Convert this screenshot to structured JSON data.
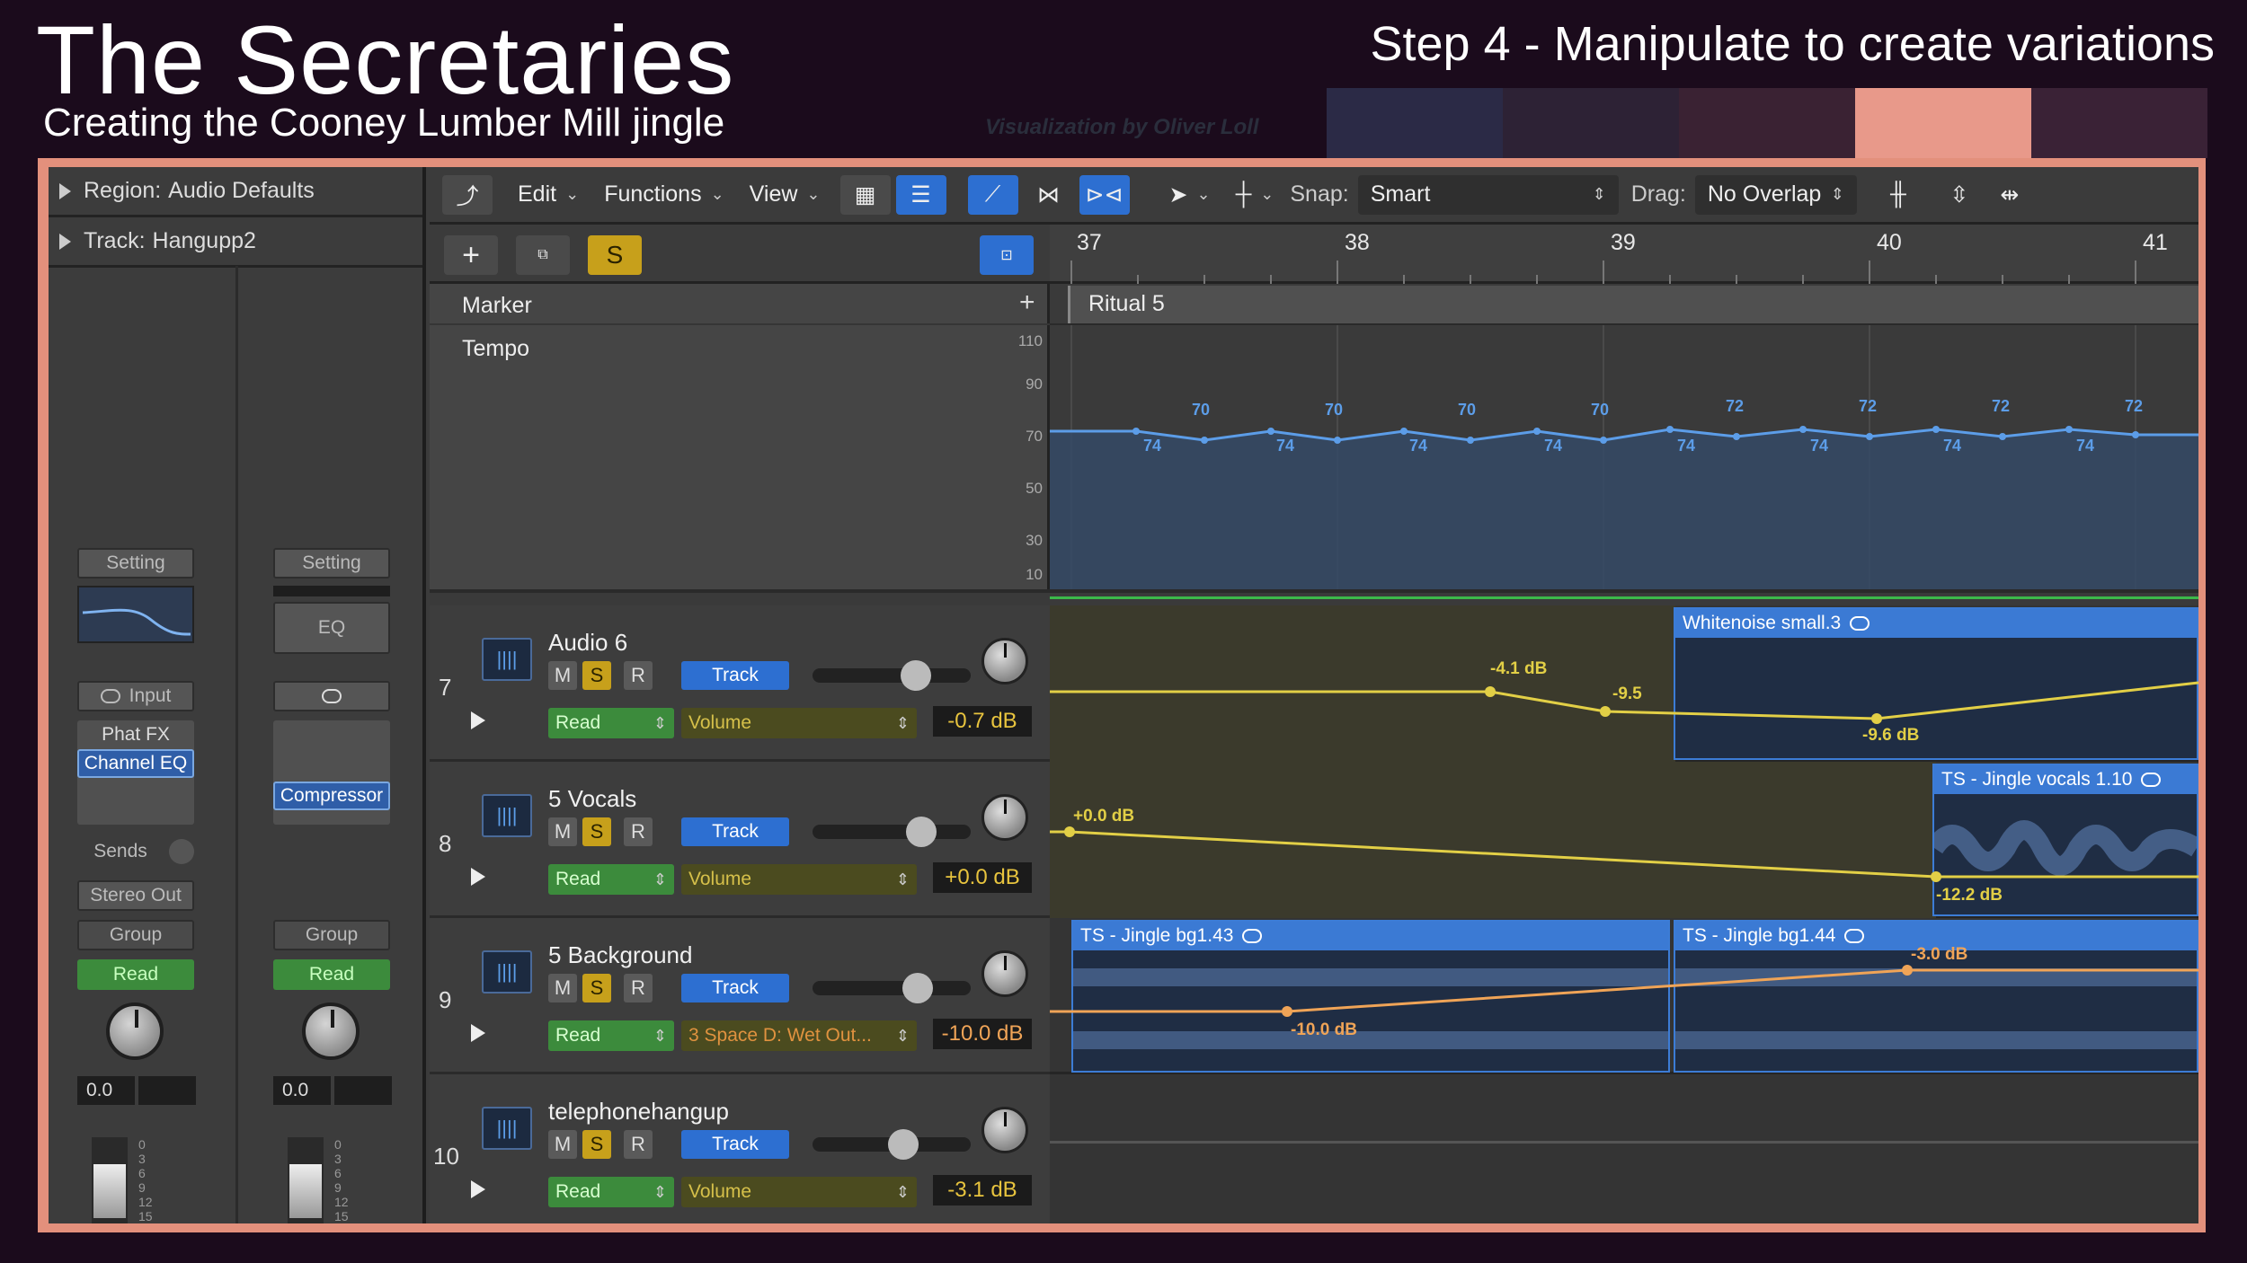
{
  "header": {
    "title": "The Secretaries",
    "subtitle": "Creating the Cooney Lumber Mill jingle",
    "step": "Step 4 - Manipulate to create variations",
    "credit": "Visualization by Oliver Loll"
  },
  "swatches": [
    "#2b2a46",
    "#2d2235",
    "#3a2233",
    "#e8998a",
    "#3a2236"
  ],
  "inspector": {
    "region_label": "Region:",
    "region_value": "Audio Defaults",
    "track_label": "Track:",
    "track_value": "Hangupp2",
    "strip1": {
      "setting": "Setting",
      "input": "Input",
      "plugin1": "Phat FX",
      "plugin2": "Channel EQ",
      "sends": "Sends",
      "output": "Stereo Out",
      "group": "Group",
      "read": "Read",
      "pan_value": "0.0"
    },
    "strip2": {
      "setting": "Setting",
      "eq": "EQ",
      "plugin": "Compressor",
      "group": "Group",
      "read": "Read",
      "pan_value": "0.0"
    },
    "meter_ticks": [
      "0",
      "3",
      "6",
      "9",
      "12",
      "15"
    ]
  },
  "toolbar": {
    "edit": "Edit",
    "functions": "Functions",
    "view": "View",
    "snap_label": "Snap:",
    "snap_value": "Smart",
    "drag_label": "Drag:",
    "drag_value": "No Overlap",
    "solo": "S"
  },
  "ruler": {
    "bars": [
      "37",
      "38",
      "39",
      "40",
      "41"
    ]
  },
  "globals": {
    "marker_label": "Marker",
    "tempo_label": "Tempo",
    "marker_name": "Ritual 5",
    "tempo_scale": [
      "110",
      "90",
      "70",
      "50",
      "30",
      "10"
    ],
    "tempo_upper": [
      "70",
      "70",
      "70",
      "70",
      "72",
      "72",
      "72",
      "72"
    ],
    "tempo_lower": [
      "74",
      "74",
      "74",
      "74",
      "74",
      "74",
      "74",
      "74"
    ]
  },
  "tracks": [
    {
      "num": "7",
      "name": "Audio 6",
      "m": "M",
      "s": "S",
      "r": "R",
      "track_btn": "Track",
      "mode": "Read",
      "param": "Volume",
      "db": "-0.7 dB"
    },
    {
      "num": "8",
      "name": "5 Vocals",
      "m": "M",
      "s": "S",
      "r": "R",
      "track_btn": "Track",
      "mode": "Read",
      "param": "Volume",
      "db": "+0.0 dB"
    },
    {
      "num": "9",
      "name": "5 Background",
      "m": "M",
      "s": "S",
      "r": "R",
      "track_btn": "Track",
      "mode": "Read",
      "param": "3 Space D: Wet Out...",
      "db": "-10.0 dB"
    },
    {
      "num": "10",
      "name": "telephonehangup",
      "m": "M",
      "s": "S",
      "r": "R",
      "track_btn": "Track",
      "mode": "Read",
      "param": "Volume",
      "db": "-3.1 dB"
    }
  ],
  "regions": {
    "whitenoise": "Whitenoise small.3",
    "vocals": "TS - Jingle vocals 1.10",
    "bg43": "TS - Jingle bg1.43",
    "bg44": "TS - Jingle bg1.44"
  },
  "automation": {
    "a1": "-4.1 dB",
    "a2": "-9.5",
    "a3": "-9.6 dB",
    "b1": "+0.0 dB",
    "b2": "-12.2 dB",
    "c1": "-10.0 dB",
    "c2": "-3.0 dB"
  },
  "colors": {
    "accent": "#e3907c",
    "region": "#3b7ad4",
    "automation": "#e2cf46",
    "automation_orange": "#f0a457"
  }
}
